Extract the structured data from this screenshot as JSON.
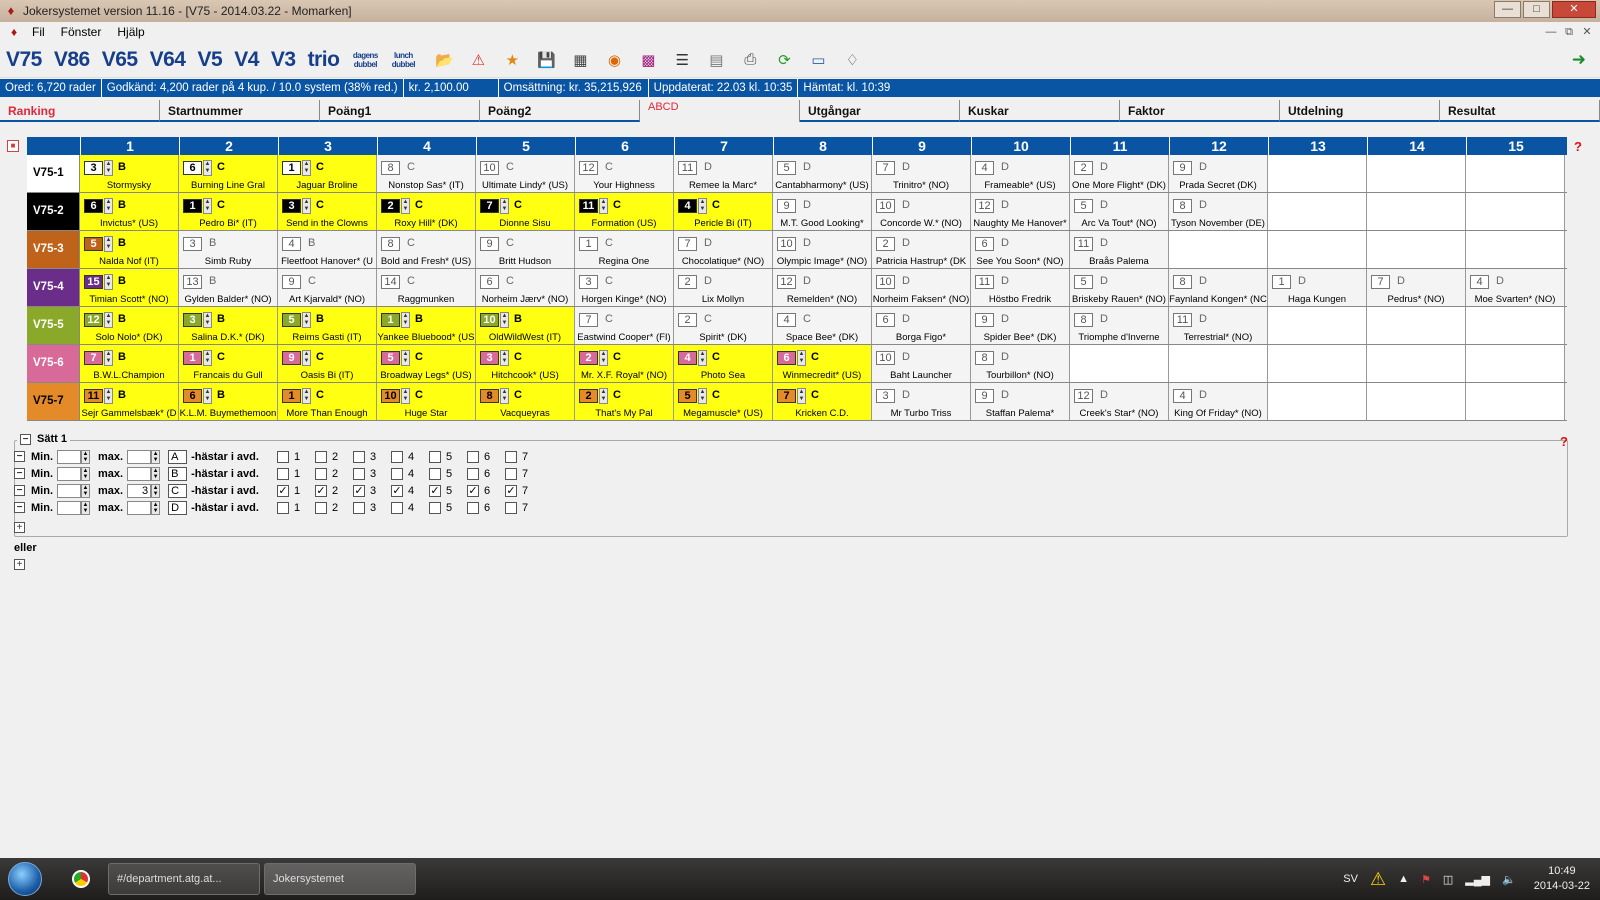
{
  "window": {
    "title": "Jokersystemet version 11.16 - [V75 - 2014.03.22 - Momarken]"
  },
  "menu": [
    "Fil",
    "Fönster",
    "Hjälp"
  ],
  "toolbar": {
    "game_buttons": [
      "V75",
      "V86",
      "V65",
      "V64",
      "V5",
      "V4",
      "V3",
      "trio"
    ],
    "small_buttons": [
      "dagens dubbel",
      "lunch dubbel"
    ],
    "icons": [
      "folder-open-icon",
      "bomb-icon",
      "folder-star-icon",
      "save-icon",
      "calendar-icon",
      "target-icon",
      "grid-icon",
      "list-icon",
      "database-icon",
      "print-icon",
      "refresh-arrow-icon",
      "ticket-icon",
      "tag-icon"
    ],
    "exit_icon": "exit-icon"
  },
  "status": [
    "Ored: 6,720 rader",
    "Godkänd: 4,200 rader på 4 kup. / 10.0 system  (38% red.)",
    "kr. 2,100.00",
    "Omsättning: kr. 35,215,926",
    "Uppdaterat: 22.03 kl. 10:35",
    "Hämtat: kl. 10:39"
  ],
  "tabs": [
    {
      "label": "Ranking",
      "style": "red"
    },
    {
      "label": "Startnummer",
      "style": ""
    },
    {
      "label": "Poäng1",
      "style": ""
    },
    {
      "label": "Poäng2",
      "style": ""
    },
    {
      "label": "ABCD",
      "style": "active"
    },
    {
      "label": "Utgångar",
      "style": ""
    },
    {
      "label": "Kuskar",
      "style": ""
    },
    {
      "label": "Faktor",
      "style": ""
    },
    {
      "label": "Utdelning",
      "style": ""
    },
    {
      "label": "Resultat",
      "style": ""
    }
  ],
  "columns": [
    "1",
    "2",
    "3",
    "4",
    "5",
    "6",
    "7",
    "8",
    "9",
    "10",
    "11",
    "12",
    "13",
    "14",
    "15"
  ],
  "help_mark": "?",
  "rows": [
    {
      "label": "V75-1",
      "color": "#ffffff",
      "textcolor": "#000000",
      "cells": [
        {
          "n": "3",
          "g": "B",
          "name": "Stormysky",
          "sel": true
        },
        {
          "n": "6",
          "g": "C",
          "name": "Burning Line Gral",
          "sel": true
        },
        {
          "n": "1",
          "g": "C",
          "name": "Jaguar Broline",
          "sel": true
        },
        {
          "n": "8",
          "g": "C",
          "name": "Nonstop Sas* (IT)"
        },
        {
          "n": "10",
          "g": "C",
          "name": "Ultimate Lindy* (US)"
        },
        {
          "n": "12",
          "g": "C",
          "name": "Your Highness"
        },
        {
          "n": "11",
          "g": "D",
          "name": "Remee la Marc*"
        },
        {
          "n": "5",
          "g": "D",
          "name": "Cantabharmony* (US)"
        },
        {
          "n": "7",
          "g": "D",
          "name": "Trinitro* (NO)"
        },
        {
          "n": "4",
          "g": "D",
          "name": "Frameable* (US)"
        },
        {
          "n": "2",
          "g": "D",
          "name": "One More Flight* (DK)"
        },
        {
          "n": "9",
          "g": "D",
          "name": "Prada Secret (DK)"
        },
        {
          "empty": true
        },
        {
          "empty": true
        },
        {
          "empty": true
        }
      ]
    },
    {
      "label": "V75-2",
      "color": "#000000",
      "textcolor": "#ffffff",
      "cells": [
        {
          "n": "6",
          "g": "B",
          "name": "Invictus* (US)",
          "sel": true
        },
        {
          "n": "1",
          "g": "C",
          "name": "Pedro Bi* (IT)",
          "sel": true
        },
        {
          "n": "3",
          "g": "C",
          "name": "Send in the Clowns",
          "sel": true
        },
        {
          "n": "2",
          "g": "C",
          "name": "Roxy Hill* (DK)",
          "sel": true
        },
        {
          "n": "7",
          "g": "C",
          "name": "Dionne Sisu",
          "sel": true
        },
        {
          "n": "11",
          "g": "C",
          "name": "Formation (US)",
          "sel": true
        },
        {
          "n": "4",
          "g": "C",
          "name": "Pericle Bi (IT)",
          "sel": true
        },
        {
          "n": "9",
          "g": "D",
          "name": "M.T. Good Looking*"
        },
        {
          "n": "10",
          "g": "D",
          "name": "Concorde W.* (NO)"
        },
        {
          "n": "12",
          "g": "D",
          "name": "Naughty Me Hanover*"
        },
        {
          "n": "5",
          "g": "D",
          "name": "Arc Va Tout* (NO)"
        },
        {
          "n": "8",
          "g": "D",
          "name": "Tyson November (DE)"
        },
        {
          "empty": true
        },
        {
          "empty": true
        },
        {
          "empty": true
        }
      ]
    },
    {
      "label": "V75-3",
      "color": "#c0631a",
      "textcolor": "#ffffff",
      "cells": [
        {
          "n": "5",
          "g": "B",
          "name": "Nalda Nof (IT)",
          "sel": true
        },
        {
          "n": "3",
          "g": "B",
          "name": "Simb Ruby"
        },
        {
          "n": "4",
          "g": "B",
          "name": "Fleetfoot Hanover* (U"
        },
        {
          "n": "8",
          "g": "C",
          "name": "Bold and Fresh* (US)"
        },
        {
          "n": "9",
          "g": "C",
          "name": "Britt Hudson"
        },
        {
          "n": "1",
          "g": "C",
          "name": "Regina One"
        },
        {
          "n": "7",
          "g": "D",
          "name": "Chocolatique* (NO)"
        },
        {
          "n": "10",
          "g": "D",
          "name": "Olympic Image* (NO)"
        },
        {
          "n": "2",
          "g": "D",
          "name": "Patricia Hastrup* (DK"
        },
        {
          "n": "6",
          "g": "D",
          "name": "See You Soon* (NO)"
        },
        {
          "n": "11",
          "g": "D",
          "name": "Braås Palema"
        },
        {
          "empty": true
        },
        {
          "empty": true
        },
        {
          "empty": true
        },
        {
          "empty": true
        }
      ]
    },
    {
      "label": "V75-4",
      "color": "#6b2d8a",
      "textcolor": "#ffffff",
      "cells": [
        {
          "n": "15",
          "g": "B",
          "name": "Timian Scott* (NO)",
          "sel": true
        },
        {
          "n": "13",
          "g": "B",
          "name": "Gylden Balder* (NO)"
        },
        {
          "n": "9",
          "g": "C",
          "name": "Art Kjarvald* (NO)"
        },
        {
          "n": "14",
          "g": "C",
          "name": "Raggmunken"
        },
        {
          "n": "6",
          "g": "C",
          "name": "Norheim Jærv* (NO)"
        },
        {
          "n": "3",
          "g": "C",
          "name": "Horgen Kinge* (NO)"
        },
        {
          "n": "2",
          "g": "D",
          "name": "Lix Mollyn"
        },
        {
          "n": "12",
          "g": "D",
          "name": "Remelden* (NO)"
        },
        {
          "n": "10",
          "g": "D",
          "name": "Norheim Faksen* (NO)"
        },
        {
          "n": "11",
          "g": "D",
          "name": "Höstbo Fredrik"
        },
        {
          "n": "5",
          "g": "D",
          "name": "Briskeby Rauen* (NO)"
        },
        {
          "n": "8",
          "g": "D",
          "name": "Faynland Kongen* (NC"
        },
        {
          "n": "1",
          "g": "D",
          "name": "Haga Kungen"
        },
        {
          "n": "7",
          "g": "D",
          "name": "Pedrus* (NO)"
        },
        {
          "n": "4",
          "g": "D",
          "name": "Moe Svarten* (NO)"
        }
      ]
    },
    {
      "label": "V75-5",
      "color": "#8aa82a",
      "textcolor": "#ffffff",
      "cells": [
        {
          "n": "12",
          "g": "B",
          "name": "Solo Nolo* (DK)",
          "sel": true
        },
        {
          "n": "3",
          "g": "B",
          "name": "Salina D.K.* (DK)",
          "sel": true
        },
        {
          "n": "5",
          "g": "B",
          "name": "Reims Gasti (IT)",
          "sel": true
        },
        {
          "n": "1",
          "g": "B",
          "name": "Yankee Bluebood* (US",
          "sel": true
        },
        {
          "n": "10",
          "g": "B",
          "name": "OldWildWest (IT)",
          "sel": true
        },
        {
          "n": "7",
          "g": "C",
          "name": "Eastwind Cooper* (FI)"
        },
        {
          "n": "2",
          "g": "C",
          "name": "Spirit* (DK)"
        },
        {
          "n": "4",
          "g": "C",
          "name": "Space Bee* (DK)"
        },
        {
          "n": "6",
          "g": "D",
          "name": "Borga Figo*"
        },
        {
          "n": "9",
          "g": "D",
          "name": "Spider Bee* (DK)"
        },
        {
          "n": "8",
          "g": "D",
          "name": "Triomphe d'Inverne"
        },
        {
          "n": "11",
          "g": "D",
          "name": "Terrestrial* (NO)"
        },
        {
          "empty": true
        },
        {
          "empty": true
        },
        {
          "empty": true
        }
      ]
    },
    {
      "label": "V75-6",
      "color": "#d86a9a",
      "textcolor": "#ffffff",
      "cells": [
        {
          "n": "7",
          "g": "B",
          "name": "B.W.L.Champion",
          "sel": true
        },
        {
          "n": "1",
          "g": "C",
          "name": "Francais du Gull",
          "sel": true
        },
        {
          "n": "9",
          "g": "C",
          "name": "Oasis Bi (IT)",
          "sel": true
        },
        {
          "n": "5",
          "g": "C",
          "name": "Broadway Legs* (US)",
          "sel": true
        },
        {
          "n": "3",
          "g": "C",
          "name": "Hitchcook* (US)",
          "sel": true
        },
        {
          "n": "2",
          "g": "C",
          "name": "Mr. X.F. Royal* (NO)",
          "sel": true
        },
        {
          "n": "4",
          "g": "C",
          "name": "Photo Sea",
          "sel": true
        },
        {
          "n": "6",
          "g": "C",
          "name": "Winmecredit* (US)",
          "sel": true
        },
        {
          "n": "10",
          "g": "D",
          "name": "Baht Launcher"
        },
        {
          "n": "8",
          "g": "D",
          "name": "Tourbillon* (NO)"
        },
        {
          "empty": true
        },
        {
          "empty": true
        },
        {
          "empty": true
        },
        {
          "empty": true
        },
        {
          "empty": true
        }
      ]
    },
    {
      "label": "V75-7",
      "color": "#e58a28",
      "textcolor": "#000000",
      "cells": [
        {
          "n": "11",
          "g": "B",
          "name": "Sejr Gammelsbæk* (D",
          "sel": true
        },
        {
          "n": "6",
          "g": "B",
          "name": "K.L.M. Buymethemoon",
          "sel": true
        },
        {
          "n": "1",
          "g": "C",
          "name": "More Than Enough",
          "sel": true
        },
        {
          "n": "10",
          "g": "C",
          "name": "Huge Star",
          "sel": true
        },
        {
          "n": "8",
          "g": "C",
          "name": "Vacqueyras",
          "sel": true
        },
        {
          "n": "2",
          "g": "C",
          "name": "That's My Pal",
          "sel": true
        },
        {
          "n": "5",
          "g": "C",
          "name": "Megamuscle* (US)",
          "sel": true
        },
        {
          "n": "7",
          "g": "C",
          "name": "Kricken C.D.",
          "sel": true
        },
        {
          "n": "3",
          "g": "D",
          "name": "Mr Turbo Triss"
        },
        {
          "n": "9",
          "g": "D",
          "name": "Staffan Palema*"
        },
        {
          "n": "12",
          "g": "D",
          "name": "Creek's Star* (NO)"
        },
        {
          "n": "4",
          "g": "D",
          "name": "King Of Friday* (NO)"
        },
        {
          "empty": true
        },
        {
          "empty": true
        },
        {
          "empty": true
        }
      ]
    }
  ],
  "satt": {
    "title": "Sätt 1",
    "min_label": "Min.",
    "max_label": "max.",
    "suffix": "-hästar i avd.",
    "conditions": [
      {
        "letter": "A",
        "min": "",
        "max": "",
        "checks": [
          false,
          false,
          false,
          false,
          false,
          false,
          false
        ]
      },
      {
        "letter": "B",
        "min": "",
        "max": "",
        "checks": [
          false,
          false,
          false,
          false,
          false,
          false,
          false
        ]
      },
      {
        "letter": "C",
        "min": "",
        "max": "3",
        "checks": [
          true,
          true,
          true,
          true,
          true,
          true,
          true
        ]
      },
      {
        "letter": "D",
        "min": "",
        "max": "",
        "checks": [
          false,
          false,
          false,
          false,
          false,
          false,
          false
        ]
      }
    ],
    "check_labels": [
      "1",
      "2",
      "3",
      "4",
      "5",
      "6",
      "7"
    ]
  },
  "eller": "eller",
  "taskbar": {
    "apps": [
      "#/department.atg.at...",
      "Jokersystemet"
    ],
    "lang": "SV",
    "time": "10:49",
    "date": "2014-03-22"
  }
}
